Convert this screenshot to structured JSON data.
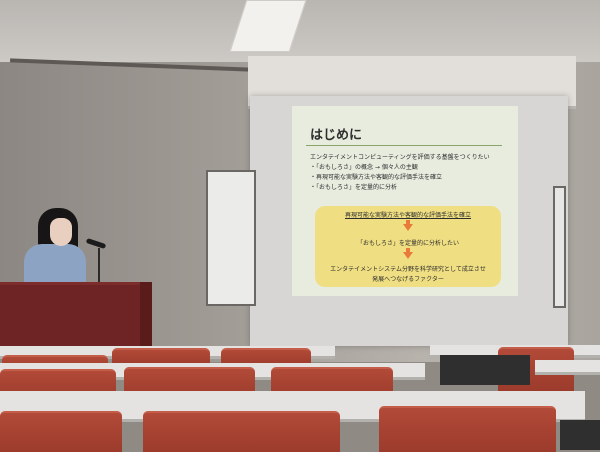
{
  "scene": {
    "description_tag": "lecture-room-presentation"
  },
  "slide": {
    "title": "はじめに",
    "intro": "エンタテイメントコンピューティングを評価する基盤をつくりたい",
    "bullets": [
      "・「おもしろさ」の概念 → 個々人の主観",
      "・再現可能な実験方法や客観的な評価手法を確立",
      "・「おもしろさ」を定量的に分析"
    ],
    "flow": [
      "再現可能な実験方法や客観的な評価手法を確立",
      "「おもしろさ」を定量的に分析したい",
      "エンタテイメントシステム分野を科学研究として成立させ",
      "発展へつなげるファクター"
    ]
  },
  "colors": {
    "slide_bg": "#e7ecdf",
    "flow_box": "#f0df82",
    "arrow": "#e87a3a",
    "podium": "#6e2424",
    "chairs": "#a8412f"
  }
}
